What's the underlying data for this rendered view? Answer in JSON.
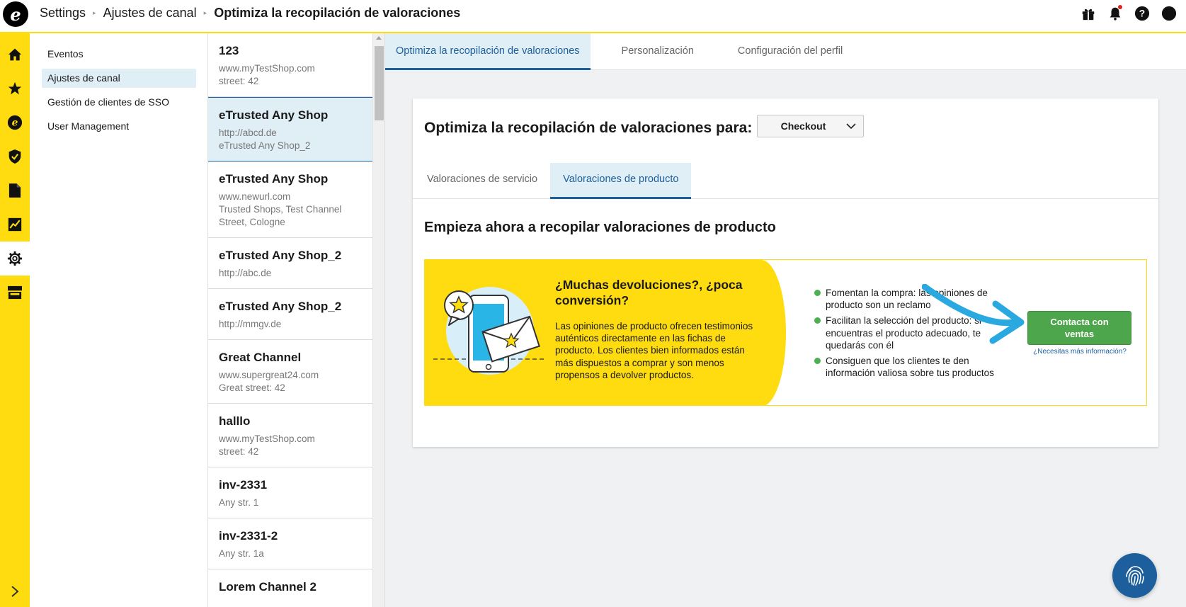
{
  "header": {
    "logo_letter": "e",
    "breadcrumb": [
      "Settings",
      "Ajustes de canal",
      "Optimiza la recopilación de valoraciones"
    ],
    "icons": [
      "gift-icon",
      "bell-icon",
      "help-icon",
      "user-avatar"
    ]
  },
  "left_nav": {
    "items": [
      "home-icon",
      "star-icon",
      "etrusted-icon",
      "shield-check-icon",
      "document-icon",
      "analytics-icon",
      "gear-icon",
      "store-icon"
    ],
    "active": "gear-icon"
  },
  "settings_menu": {
    "items": [
      {
        "label": "Eventos"
      },
      {
        "label": "Ajustes de canal"
      },
      {
        "label": "Gestión de clientes de SSO"
      },
      {
        "label": "User Management"
      }
    ],
    "active_index": 1
  },
  "channels": [
    {
      "name": "123",
      "lines": [
        "www.myTestShop.com",
        "street: 42"
      ]
    },
    {
      "name": "eTrusted Any Shop",
      "lines": [
        "http://abcd.de",
        "eTrusted Any Shop_2"
      ]
    },
    {
      "name": "eTrusted Any Shop",
      "lines": [
        "www.newurl.com",
        "Trusted Shops, Test Channel",
        "Street, Cologne"
      ]
    },
    {
      "name": "eTrusted Any Shop_2",
      "lines": [
        "http://abc.de"
      ]
    },
    {
      "name": "eTrusted Any Shop_2",
      "lines": [
        "http://mmgv.de"
      ]
    },
    {
      "name": "Great Channel",
      "lines": [
        "www.supergreat24.com",
        "Great street: 42"
      ]
    },
    {
      "name": "halllo",
      "lines": [
        "www.myTestShop.com",
        "street: 42"
      ]
    },
    {
      "name": "inv-2331",
      "lines": [
        "Any str. 1"
      ]
    },
    {
      "name": "inv-2331-2",
      "lines": [
        "Any str. 1a"
      ]
    },
    {
      "name": "Lorem Channel 2",
      "lines": []
    }
  ],
  "channels_active_index": 1,
  "main_tabs": [
    {
      "label": "Optimiza la recopilación de valoraciones"
    },
    {
      "label": "Personalización"
    },
    {
      "label": "Configuración del perfil"
    }
  ],
  "main_tabs_active_index": 0,
  "card": {
    "title": "Optimiza la recopilación de valoraciones para:",
    "dropdown_value": "Checkout",
    "sub_tabs": [
      {
        "label": "Valoraciones de servicio"
      },
      {
        "label": "Valoraciones de producto"
      }
    ],
    "sub_tabs_active_index": 1,
    "section_title": "Empieza ahora a recopilar valoraciones de producto"
  },
  "promo": {
    "heading": "¿Muchas devoluciones?, ¿poca conversión?",
    "text": "Las opiniones de producto ofrecen testimonios auténticos directamente en las fichas de producto. Los clientes bien informados están más dispuestos a comprar y son menos propensos a devolver productos.",
    "benefits": [
      "Fomentan la compra: las opiniones de producto son un reclamo",
      "Facilitan la selección del producto: si encuentras el producto adecuado, te quedarás con él",
      "Consiguen que los clientes te den información valiosa sobre tus productos"
    ],
    "button_label": "Contacta con ventas",
    "more_info_link": "¿Necesitas más información?"
  },
  "colors": {
    "brand_yellow": "#ffdc0f",
    "accent_blue": "#1c5f9c",
    "selected_bg": "#e0eef6",
    "button_green": "#4ea64c",
    "annotation_arrow": "#29a9e0"
  },
  "fab_icon": "fingerprint-icon"
}
